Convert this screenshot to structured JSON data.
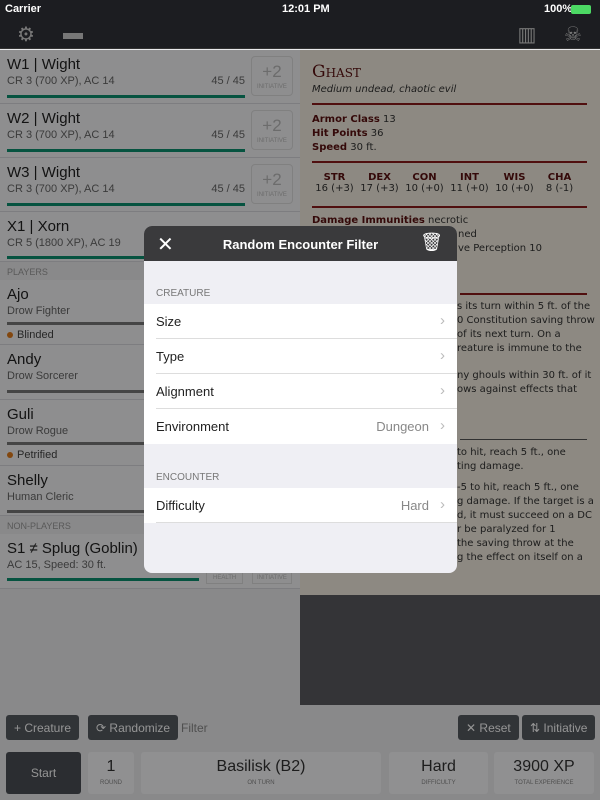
{
  "status": {
    "carrier": "Carrier",
    "time": "12:01 PM",
    "battery": "100%"
  },
  "toolbar": {
    "left_icons": [
      "gear-icon",
      "folder-icon"
    ],
    "right_icons": [
      "book-icon",
      "demon-skull-icon"
    ]
  },
  "creatures": [
    {
      "name": "W1 | Wight",
      "sub": "CR 3 (700 XP), AC 14",
      "hp": "45 / 45",
      "init": "+2",
      "health": 1.0
    },
    {
      "name": "W2 | Wight",
      "sub": "CR 3 (700 XP), AC 14",
      "hp": "45 / 45",
      "init": "+2",
      "health": 1.0
    },
    {
      "name": "W3 | Wight",
      "sub": "CR 3 (700 XP), AC 14",
      "hp": "45 / 45",
      "init": "+2",
      "health": 1.0
    },
    {
      "name": "X1 | Xorn",
      "sub": "CR 5 (1800 XP), AC 19"
    }
  ],
  "init_label": "INITIATIVE",
  "players_label": "PLAYERS",
  "players": [
    {
      "name": "Ajo",
      "sub": "Drow Fighter",
      "condition": "Blinded"
    },
    {
      "name": "Andy",
      "sub": "Drow Sorcerer"
    },
    {
      "name": "Guli",
      "sub": "Drow Rogue",
      "condition": "Petrified"
    },
    {
      "name": "Shelly",
      "sub": "Human Cleric"
    }
  ],
  "nonplayers_label": "NON-PLAYERS",
  "nonplayers": [
    {
      "name": "S1 ≠ Splug (Goblin)",
      "sub": "AC 15, Speed: 30 ft.",
      "health_label": "HEALTH",
      "init_label": "INITIATIVE"
    }
  ],
  "statblock": {
    "name": "Ghast",
    "meta": "Medium undead, chaotic evil",
    "ac_label": "Armor Class",
    "ac": "13",
    "hp_label": "Hit Points",
    "hp": "36",
    "speed_label": "Speed",
    "speed": "30 ft.",
    "abilities": [
      {
        "k": "STR",
        "v": "16 (+3)"
      },
      {
        "k": "DEX",
        "v": "17 (+3)"
      },
      {
        "k": "CON",
        "v": "10 (+0)"
      },
      {
        "k": "INT",
        "v": "11 (+0)"
      },
      {
        "k": "WIS",
        "v": "10 (+0)"
      },
      {
        "k": "CHA",
        "v": "8 (-1)"
      }
    ],
    "imm_label": "Damage Immunities",
    "imm": "necrotic",
    "fragments": [
      "ned",
      "ve Perception 10",
      "s its turn within 5 ft. of the",
      "0 Constitution saving throw",
      "of its next turn. On a",
      "reature is immune to the",
      "ny ghouls within 30 ft. of it",
      "ows against effects that",
      "to hit, reach 5 ft., one",
      "ting damage.",
      "-5 to hit, reach 5 ft., one",
      "g damage. If the target is a",
      "d, it must succeed on a DC",
      "r be paralyzed for 1",
      "the saving throw at the",
      "g the effect on itself on a"
    ]
  },
  "actions": {
    "creature": "+ Creature",
    "randomize": "Randomize",
    "filter": "Filter",
    "reset": "Reset",
    "initiative": "Initiative"
  },
  "footer": {
    "start": "Start",
    "round": "1",
    "round_label": "ROUND",
    "on_turn": "Basilisk (B2)",
    "on_turn_label": "ON TURN",
    "difficulty": "Hard",
    "difficulty_label": "DIFFICULTY",
    "xp": "3900 XP",
    "xp_label": "TOTAL EXPERIENCE"
  },
  "modal": {
    "title": "Random Encounter Filter",
    "creature_section": "CREATURE",
    "rows": [
      {
        "label": "Size",
        "value": ""
      },
      {
        "label": "Type",
        "value": ""
      },
      {
        "label": "Alignment",
        "value": ""
      },
      {
        "label": "Environment",
        "value": "Dungeon"
      }
    ],
    "encounter_section": "ENCOUNTER",
    "difficulty": {
      "label": "Difficulty",
      "value": "Hard"
    }
  },
  "colors": {
    "health": "#0b8f6e",
    "condition": "#e07a1a",
    "statblock_rule": "#8b1a1a",
    "battery": "#4cd964"
  }
}
